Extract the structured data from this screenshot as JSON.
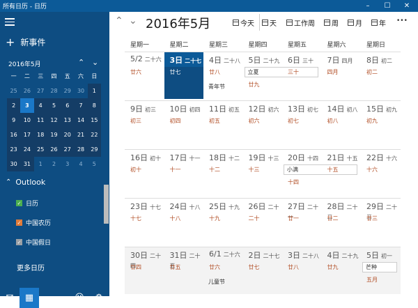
{
  "window": {
    "title": "所有日历 - 日历",
    "minimize": "–",
    "maximize": "☐",
    "close": "✕"
  },
  "sidebar": {
    "new_event": "新事件",
    "mini_cal": {
      "title": "2016年5月",
      "dow": [
        "一",
        "二",
        "三",
        "四",
        "五",
        "六",
        "日"
      ],
      "weeks": [
        [
          "25",
          "26",
          "27",
          "28",
          "29",
          "30",
          "1"
        ],
        [
          "2",
          "3",
          "4",
          "5",
          "6",
          "7",
          "8"
        ],
        [
          "9",
          "10",
          "11",
          "12",
          "13",
          "14",
          "15"
        ],
        [
          "16",
          "17",
          "18",
          "19",
          "20",
          "21",
          "22"
        ],
        [
          "23",
          "24",
          "25",
          "26",
          "27",
          "28",
          "29"
        ],
        [
          "30",
          "31",
          "1",
          "2",
          "3",
          "4",
          "5"
        ]
      ]
    },
    "outlook": "Outlook",
    "calendars": [
      {
        "label": "日历",
        "color": "#4caf50"
      },
      {
        "label": "中国农历",
        "color": "#e07b39"
      },
      {
        "label": "中国假日",
        "color": "#9aa0a6"
      }
    ],
    "more_calendars": "更多日历"
  },
  "toolbar": {
    "month_title": "2016年5月",
    "today": "今天",
    "day": "天",
    "work_week": "工作周",
    "week": "周",
    "month": "月",
    "year": "年",
    "more": "•••"
  },
  "grid": {
    "dow": [
      "星期一",
      "星期二",
      "星期三",
      "星期四",
      "星期五",
      "星期六",
      "星期日"
    ],
    "weeks": [
      [
        {
          "num": "5/2",
          "lunar_top": "二十六",
          "lunar": "廿六"
        },
        {
          "num": "3日",
          "lunar_top": "二十七",
          "lunar": "廿七",
          "today": true
        },
        {
          "num": "4日",
          "lunar_top": "二十八",
          "lunar": "廿八",
          "event": "青年节"
        },
        {
          "num": "5日",
          "lunar_top": "二十九",
          "lunar": "廿九",
          "box": "立夏"
        },
        {
          "num": "6日",
          "lunar_top": "三十",
          "lunar": "三十"
        },
        {
          "num": "7日",
          "lunar_top": "四月",
          "lunar": "四月"
        },
        {
          "num": "8日",
          "lunar_top": "初二",
          "lunar": "初二"
        }
      ],
      [
        {
          "num": "9日",
          "lunar_top": "初三",
          "lunar": "初三"
        },
        {
          "num": "10日",
          "lunar_top": "初四",
          "lunar": "初四"
        },
        {
          "num": "11日",
          "lunar_top": "初五",
          "lunar": "初五"
        },
        {
          "num": "12日",
          "lunar_top": "初六",
          "lunar": "初六"
        },
        {
          "num": "13日",
          "lunar_top": "初七",
          "lunar": "初七"
        },
        {
          "num": "14日",
          "lunar_top": "初八",
          "lunar": "初八"
        },
        {
          "num": "15日",
          "lunar_top": "初九",
          "lunar": "初九"
        }
      ],
      [
        {
          "num": "16日",
          "lunar_top": "初十",
          "lunar": "初十"
        },
        {
          "num": "17日",
          "lunar_top": "十一",
          "lunar": "十一"
        },
        {
          "num": "18日",
          "lunar_top": "十二",
          "lunar": "十二"
        },
        {
          "num": "19日",
          "lunar_top": "十三",
          "lunar": "十三"
        },
        {
          "num": "20日",
          "lunar_top": "十四",
          "lunar": "十四",
          "box": "小满"
        },
        {
          "num": "21日",
          "lunar_top": "十五",
          "lunar": "十五"
        },
        {
          "num": "22日",
          "lunar_top": "十六",
          "lunar": "十六"
        }
      ],
      [
        {
          "num": "23日",
          "lunar_top": "十七",
          "lunar": "十七"
        },
        {
          "num": "24日",
          "lunar_top": "十八",
          "lunar": "十八"
        },
        {
          "num": "25日",
          "lunar_top": "十九",
          "lunar": "十九"
        },
        {
          "num": "26日",
          "lunar_top": "二十",
          "lunar": "二十"
        },
        {
          "num": "27日",
          "lunar_top": "二十一",
          "lunar": "廿一"
        },
        {
          "num": "28日",
          "lunar_top": "二十二",
          "lunar": "廿二"
        },
        {
          "num": "29日",
          "lunar_top": "二十三",
          "lunar": "廿三"
        }
      ],
      [
        {
          "num": "30日",
          "lunar_top": "二十四",
          "lunar": "廿四"
        },
        {
          "num": "31日",
          "lunar_top": "二十五",
          "lunar": "廿五"
        },
        {
          "num": "6/1",
          "lunar_top": "二十六",
          "lunar": "廿六",
          "event": "儿童节"
        },
        {
          "num": "2日",
          "lunar_top": "二十七",
          "lunar": "廿七"
        },
        {
          "num": "3日",
          "lunar_top": "二十八",
          "lunar": "廿八"
        },
        {
          "num": "4日",
          "lunar_top": "二十九",
          "lunar": "廿九"
        },
        {
          "num": "5日",
          "lunar_top": "初一",
          "lunar": "五月",
          "box": "芒种"
        }
      ]
    ]
  }
}
